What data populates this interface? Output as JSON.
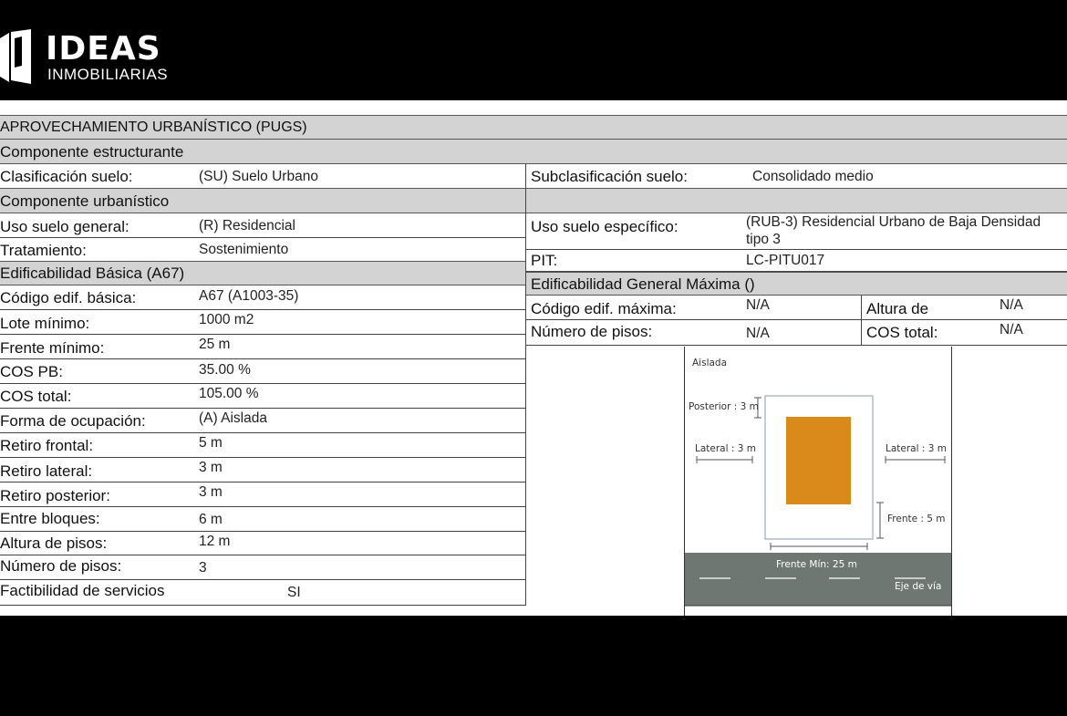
{
  "brand": {
    "title": "IDEAS",
    "subtitle": "INMOBILIARIAS"
  },
  "header": {
    "title": "APROVECHAMIENTO URBANÍSTICO (PUGS)"
  },
  "estructurante": {
    "section": "Componente  estructurante",
    "clasificacion_label": "Clasificación suelo:",
    "clasificacion_value": "(SU) Suelo Urbano",
    "subclasificacion_label": "Subclasificación suelo:",
    "subclasificacion_value": "Consolidado medio"
  },
  "urbanistico": {
    "section": "Componente  urbanístico",
    "uso_general_label": "Uso suelo general:",
    "uso_general_value": "(R) Residencial",
    "uso_especifico_label": "Uso suelo específico:",
    "uso_especifico_line1": "(RUB-3) Residencial Urbano de Baja Densidad",
    "uso_especifico_line2": "tipo 3",
    "tratamiento_label": "Tratamiento:",
    "tratamiento_value": "Sostenimiento",
    "pit_label": "PIT:",
    "pit_value": "LC-PITU017"
  },
  "basica": {
    "section": "Edificabilidad Básica (A67)",
    "rows": [
      {
        "label": "Código edif. básica:",
        "value": "A67 (A1003-35)"
      },
      {
        "label": "Lote mínimo:",
        "value": "1000 m2"
      },
      {
        "label": "Frente mínimo:",
        "value": "25 m"
      },
      {
        "label": "COS PB:",
        "value": "35.00 %"
      },
      {
        "label": "COS total:",
        "value": "105.00 %"
      },
      {
        "label": "Forma de ocupación:",
        "value": "(A) Aislada"
      },
      {
        "label": "Retiro frontal:",
        "value": "5 m"
      },
      {
        "label": "Retiro lateral:",
        "value": "3 m"
      },
      {
        "label": "Retiro posterior:",
        "value": "3 m"
      },
      {
        "label": "Entre bloques:",
        "value": "6 m"
      },
      {
        "label": "Altura de pisos:",
        "value": "12 m"
      },
      {
        "label": "Número de pisos:",
        "value": "3"
      },
      {
        "label": "Factibilidad de servicios",
        "value": "SI"
      }
    ]
  },
  "maxima": {
    "section": "Edificabilidad General Máxima ()",
    "codigo_label": "Código edif. máxima:",
    "codigo_value": "N/A",
    "altura_label": "Altura de",
    "altura_value": "N/A",
    "pisos_label": "Número de pisos:",
    "pisos_value": "N/A",
    "cos_label": "COS total:",
    "cos_value": "N/A"
  },
  "diagram": {
    "tipo": "Aislada",
    "posterior": "Posterior : 3 m",
    "lateral_left": "Lateral : 3 m",
    "lateral_right": "Lateral : 3 m",
    "frente": "Frente : 5 m",
    "frente_min": "Frente Mín: 25 m",
    "eje": "Eje de vía",
    "building_color": "#d98a1a",
    "road_color": "#6f7773"
  }
}
